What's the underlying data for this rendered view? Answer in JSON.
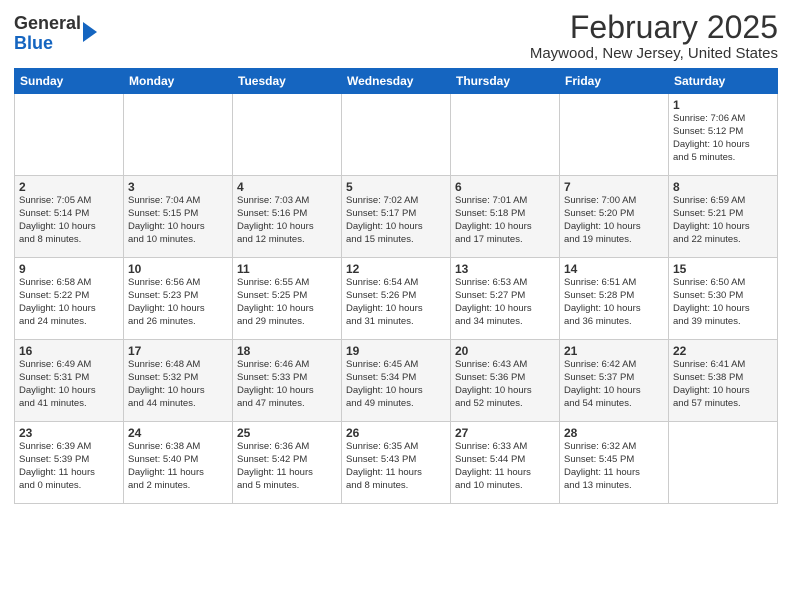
{
  "logo": {
    "general": "General",
    "blue": "Blue"
  },
  "title": "February 2025",
  "subtitle": "Maywood, New Jersey, United States",
  "days_of_week": [
    "Sunday",
    "Monday",
    "Tuesday",
    "Wednesday",
    "Thursday",
    "Friday",
    "Saturday"
  ],
  "weeks": [
    [
      {
        "day": "",
        "info": ""
      },
      {
        "day": "",
        "info": ""
      },
      {
        "day": "",
        "info": ""
      },
      {
        "day": "",
        "info": ""
      },
      {
        "day": "",
        "info": ""
      },
      {
        "day": "",
        "info": ""
      },
      {
        "day": "1",
        "info": "Sunrise: 7:06 AM\nSunset: 5:12 PM\nDaylight: 10 hours\nand 5 minutes."
      }
    ],
    [
      {
        "day": "2",
        "info": "Sunrise: 7:05 AM\nSunset: 5:14 PM\nDaylight: 10 hours\nand 8 minutes."
      },
      {
        "day": "3",
        "info": "Sunrise: 7:04 AM\nSunset: 5:15 PM\nDaylight: 10 hours\nand 10 minutes."
      },
      {
        "day": "4",
        "info": "Sunrise: 7:03 AM\nSunset: 5:16 PM\nDaylight: 10 hours\nand 12 minutes."
      },
      {
        "day": "5",
        "info": "Sunrise: 7:02 AM\nSunset: 5:17 PM\nDaylight: 10 hours\nand 15 minutes."
      },
      {
        "day": "6",
        "info": "Sunrise: 7:01 AM\nSunset: 5:18 PM\nDaylight: 10 hours\nand 17 minutes."
      },
      {
        "day": "7",
        "info": "Sunrise: 7:00 AM\nSunset: 5:20 PM\nDaylight: 10 hours\nand 19 minutes."
      },
      {
        "day": "8",
        "info": "Sunrise: 6:59 AM\nSunset: 5:21 PM\nDaylight: 10 hours\nand 22 minutes."
      }
    ],
    [
      {
        "day": "9",
        "info": "Sunrise: 6:58 AM\nSunset: 5:22 PM\nDaylight: 10 hours\nand 24 minutes."
      },
      {
        "day": "10",
        "info": "Sunrise: 6:56 AM\nSunset: 5:23 PM\nDaylight: 10 hours\nand 26 minutes."
      },
      {
        "day": "11",
        "info": "Sunrise: 6:55 AM\nSunset: 5:25 PM\nDaylight: 10 hours\nand 29 minutes."
      },
      {
        "day": "12",
        "info": "Sunrise: 6:54 AM\nSunset: 5:26 PM\nDaylight: 10 hours\nand 31 minutes."
      },
      {
        "day": "13",
        "info": "Sunrise: 6:53 AM\nSunset: 5:27 PM\nDaylight: 10 hours\nand 34 minutes."
      },
      {
        "day": "14",
        "info": "Sunrise: 6:51 AM\nSunset: 5:28 PM\nDaylight: 10 hours\nand 36 minutes."
      },
      {
        "day": "15",
        "info": "Sunrise: 6:50 AM\nSunset: 5:30 PM\nDaylight: 10 hours\nand 39 minutes."
      }
    ],
    [
      {
        "day": "16",
        "info": "Sunrise: 6:49 AM\nSunset: 5:31 PM\nDaylight: 10 hours\nand 41 minutes."
      },
      {
        "day": "17",
        "info": "Sunrise: 6:48 AM\nSunset: 5:32 PM\nDaylight: 10 hours\nand 44 minutes."
      },
      {
        "day": "18",
        "info": "Sunrise: 6:46 AM\nSunset: 5:33 PM\nDaylight: 10 hours\nand 47 minutes."
      },
      {
        "day": "19",
        "info": "Sunrise: 6:45 AM\nSunset: 5:34 PM\nDaylight: 10 hours\nand 49 minutes."
      },
      {
        "day": "20",
        "info": "Sunrise: 6:43 AM\nSunset: 5:36 PM\nDaylight: 10 hours\nand 52 minutes."
      },
      {
        "day": "21",
        "info": "Sunrise: 6:42 AM\nSunset: 5:37 PM\nDaylight: 10 hours\nand 54 minutes."
      },
      {
        "day": "22",
        "info": "Sunrise: 6:41 AM\nSunset: 5:38 PM\nDaylight: 10 hours\nand 57 minutes."
      }
    ],
    [
      {
        "day": "23",
        "info": "Sunrise: 6:39 AM\nSunset: 5:39 PM\nDaylight: 11 hours\nand 0 minutes."
      },
      {
        "day": "24",
        "info": "Sunrise: 6:38 AM\nSunset: 5:40 PM\nDaylight: 11 hours\nand 2 minutes."
      },
      {
        "day": "25",
        "info": "Sunrise: 6:36 AM\nSunset: 5:42 PM\nDaylight: 11 hours\nand 5 minutes."
      },
      {
        "day": "26",
        "info": "Sunrise: 6:35 AM\nSunset: 5:43 PM\nDaylight: 11 hours\nand 8 minutes."
      },
      {
        "day": "27",
        "info": "Sunrise: 6:33 AM\nSunset: 5:44 PM\nDaylight: 11 hours\nand 10 minutes."
      },
      {
        "day": "28",
        "info": "Sunrise: 6:32 AM\nSunset: 5:45 PM\nDaylight: 11 hours\nand 13 minutes."
      },
      {
        "day": "",
        "info": ""
      }
    ]
  ]
}
